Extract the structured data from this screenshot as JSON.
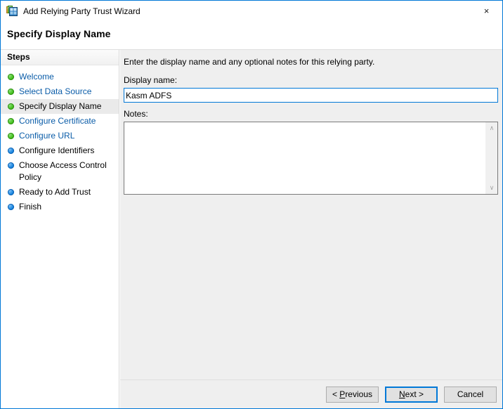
{
  "window": {
    "title": "Add Relying Party Trust Wizard",
    "icon": "relying-party-trust-icon",
    "close_label": "×",
    "border_color": "#0078d7"
  },
  "page": {
    "title": "Specify Display Name"
  },
  "sidebar": {
    "header": "Steps",
    "items": [
      {
        "label": "Welcome",
        "state": "completed",
        "bullet": "green"
      },
      {
        "label": "Select Data Source",
        "state": "completed",
        "bullet": "green"
      },
      {
        "label": "Specify Display Name",
        "state": "current",
        "bullet": "green"
      },
      {
        "label": "Configure Certificate",
        "state": "completed",
        "bullet": "green"
      },
      {
        "label": "Configure URL",
        "state": "completed",
        "bullet": "green"
      },
      {
        "label": "Configure Identifiers",
        "state": "pending",
        "bullet": "blue"
      },
      {
        "label": "Choose Access Control Policy",
        "state": "pending",
        "bullet": "blue"
      },
      {
        "label": "Ready to Add Trust",
        "state": "pending",
        "bullet": "blue"
      },
      {
        "label": "Finish",
        "state": "pending",
        "bullet": "blue"
      }
    ]
  },
  "main": {
    "intro": "Enter the display name and any optional notes for this relying party.",
    "display_name": {
      "label": "Display name:",
      "value": "Kasm ADFS",
      "placeholder": ""
    },
    "notes": {
      "label": "Notes:",
      "value": "",
      "placeholder": ""
    },
    "scrollbar": {
      "up_icon": "chevron-up-icon",
      "down_icon": "chevron-down-icon",
      "up_glyph": "∧",
      "down_glyph": "∨"
    }
  },
  "buttons": {
    "previous": {
      "prefix": "< ",
      "accel": "P",
      "rest": "revious"
    },
    "next": {
      "accel": "N",
      "rest": "ext >"
    },
    "cancel": {
      "label": "Cancel"
    }
  },
  "colors": {
    "accent": "#0078d7",
    "link": "#0a5ca8",
    "content_bg": "#efefef",
    "sidebar_bg": "#ffffff",
    "completed_bullet": "#45c11f",
    "pending_bullet": "#1a86e0"
  }
}
